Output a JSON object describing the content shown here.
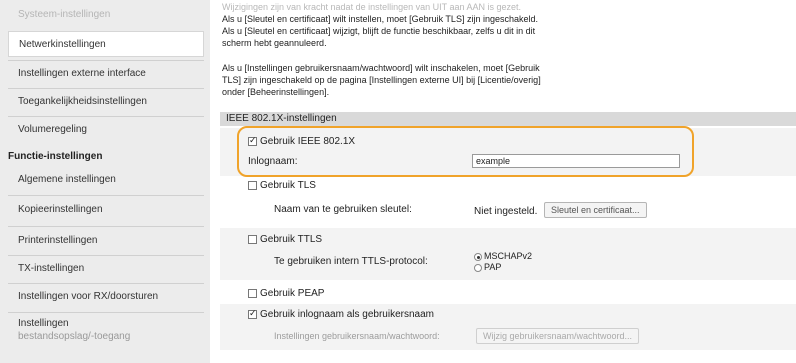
{
  "sidebar": {
    "items": [
      {
        "label": "Systeem-instellingen"
      },
      {
        "label": "Netwerkinstellingen"
      },
      {
        "label": "Instellingen externe interface"
      },
      {
        "label": "Toegankelijkheidsinstellingen"
      },
      {
        "label": "Volumeregeling"
      },
      {
        "label": "Algemene instellingen"
      },
      {
        "label": "Kopieerinstellingen"
      },
      {
        "label": "Printerinstellingen"
      },
      {
        "label": "TX-instellingen"
      },
      {
        "label": "Instellingen voor RX/doorsturen"
      },
      {
        "label": "Instellingen"
      },
      {
        "label": "bestandsopslag/-toegang"
      }
    ],
    "section_label": "Functie-instellingen"
  },
  "notes": {
    "line1": "Wijzigingen zijn van kracht nadat de instellingen van UIT aan AAN is gezet.",
    "line2": "Als u [Sleutel en certificaat] wilt instellen, moet [Gebruik TLS] zijn ingeschakeld.",
    "line3": "Als u [Sleutel en certificaat] wijzigt, blijft de functie beschikbaar, zelfs u dit in dit",
    "line4": "scherm hebt geannuleerd.",
    "line5": "Als u [Instellingen gebruikersnaam/wachtwoord] wilt inschakelen, moet [Gebruik",
    "line6": "TLS] zijn ingeschakeld op de pagina [Instellingen externe UI] bij [Licentie/overig]",
    "line7": "onder [Beheerinstellingen]."
  },
  "section": {
    "title": "IEEE 802.1X-instellingen"
  },
  "ieee": {
    "use_label": "Gebruik IEEE 802.1X",
    "use_checked": true,
    "login_label": "Inlognaam:",
    "login_value": "example"
  },
  "tls": {
    "use_label": "Gebruik TLS",
    "key_label": "Naam van te gebruiken sleutel:",
    "key_value": "Niet ingesteld.",
    "key_button": "Sleutel en certificaat..."
  },
  "ttls": {
    "use_label": "Gebruik TTLS",
    "protocol_label": "Te gebruiken intern TTLS-protocol:",
    "options": [
      "MSCHAPv2",
      "PAP"
    ],
    "selected": "MSCHAPv2"
  },
  "peap": {
    "use_label": "Gebruik PEAP"
  },
  "login_as_user": {
    "label": "Gebruik inlognaam als gebruikersnaam",
    "checked": true
  },
  "credentials": {
    "label": "Instellingen gebruikersnaam/wachtwoord:",
    "button": "Wijzig gebruikersnaam/wachtwoord..."
  },
  "colors": {
    "highlight": "#f0a32a",
    "sidebar_bg": "#ececec",
    "section_header": "#d9d9d9"
  }
}
